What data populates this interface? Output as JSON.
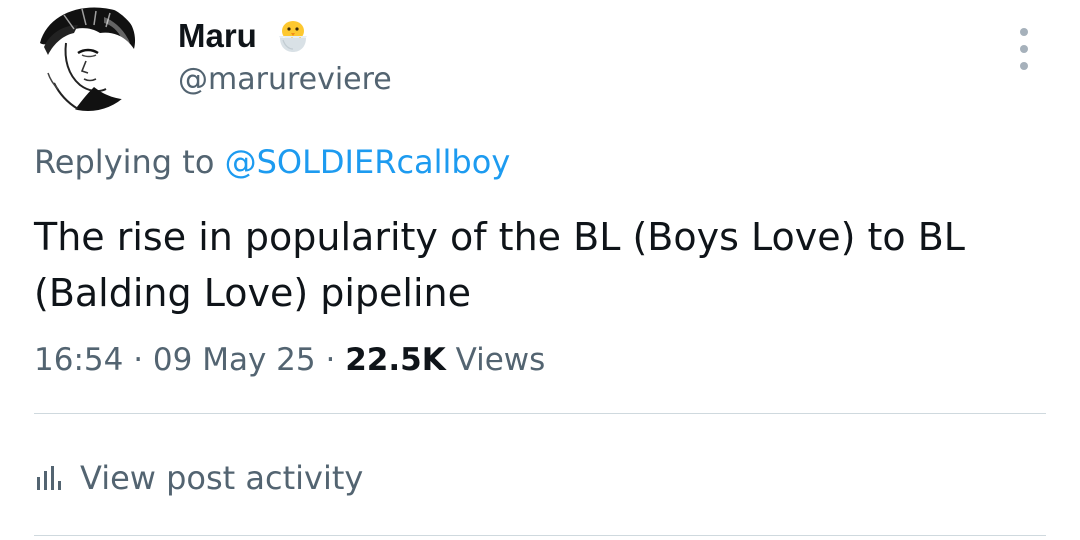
{
  "author": {
    "display_name": "Maru",
    "name_emoji": "hatching-chick-icon",
    "handle": "@marureviere",
    "avatar": "manga-style-portrait-avatar"
  },
  "reply": {
    "prefix": "Replying to ",
    "mention": "@SOLDIERcallboy"
  },
  "tweet": {
    "text": "The rise in popularity of the BL (Boys Love) to BL (Balding Love) pipeline"
  },
  "meta": {
    "time": "16:54",
    "separator": "·",
    "date": "09 May 25",
    "views_count": "22.5K",
    "views_label": "Views"
  },
  "activity": {
    "label": "View post activity",
    "icon": "bar-chart-icon"
  },
  "menu": {
    "icon": "more-vertical-icon"
  },
  "colors": {
    "text_primary": "#0f1419",
    "text_secondary": "#536471",
    "accent": "#1d9bf0",
    "divider": "#cfd9de"
  }
}
